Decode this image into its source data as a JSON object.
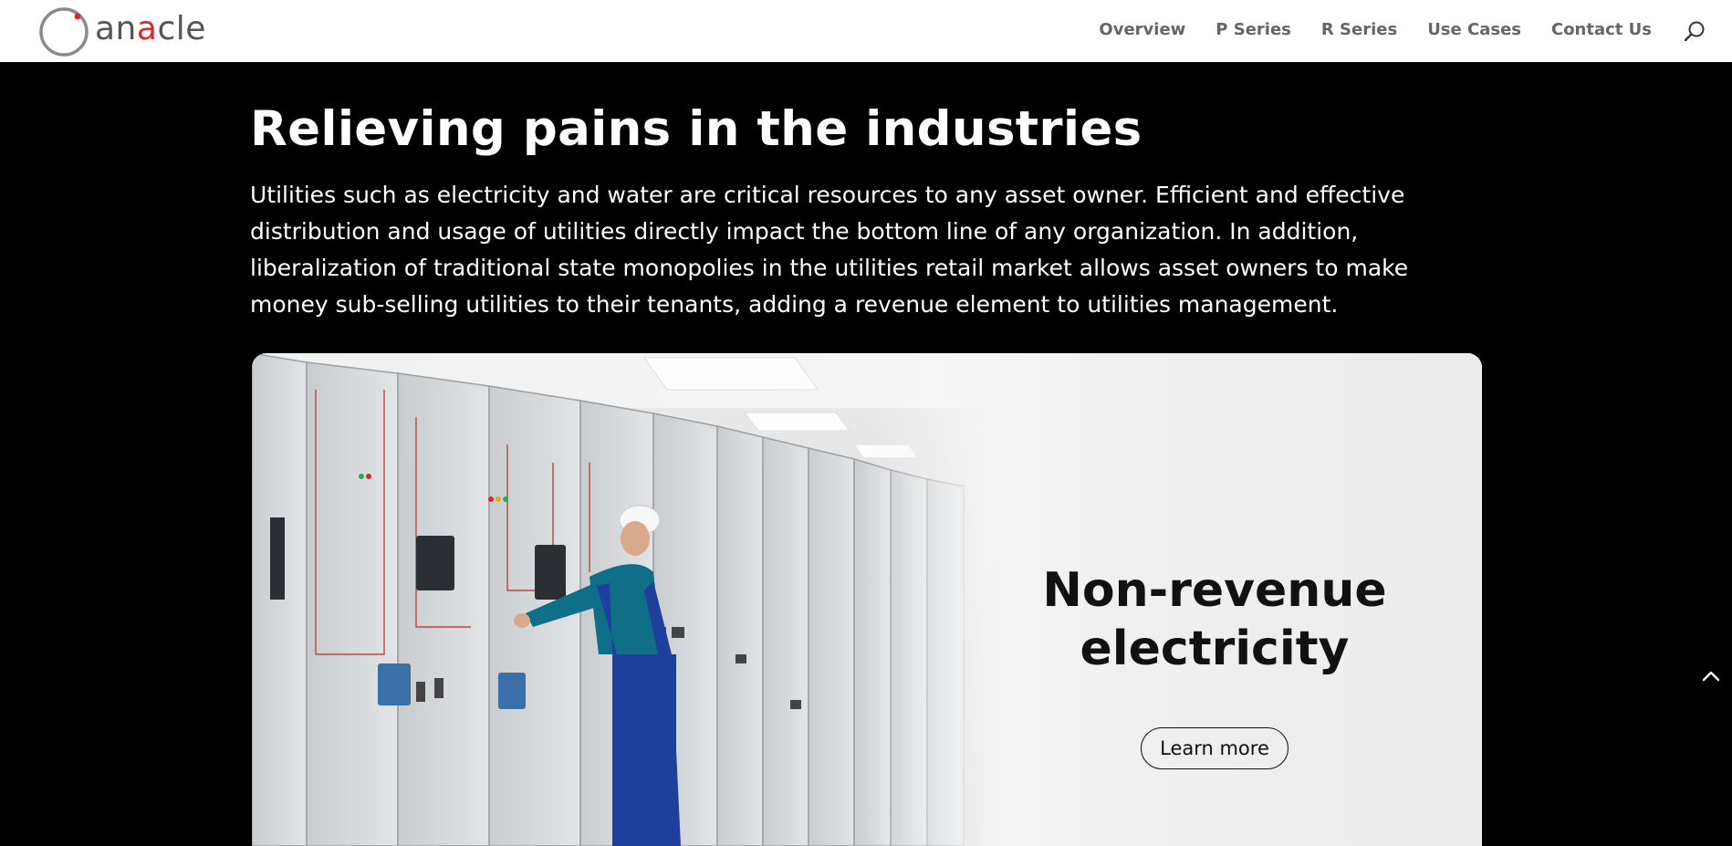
{
  "header": {
    "logo": {
      "prefix": "an",
      "accent": "a",
      "suffix": "cle"
    },
    "nav": [
      {
        "label": "Overview"
      },
      {
        "label": "P Series"
      },
      {
        "label": "R Series"
      },
      {
        "label": "Use Cases"
      },
      {
        "label": "Contact Us"
      }
    ],
    "search_icon": "search-icon"
  },
  "hero": {
    "title": "Relieving pains in the industries",
    "body": "Utilities such as electricity and water are critical resources to any asset owner.  Efficient and effective distribution and usage of utilities directly impact the bottom line of any organization. In addition, liberalization of traditional state monopolies in the utilities retail market allows asset owners to make money sub-selling utilities to their tenants, adding a revenue element to utilities management."
  },
  "card": {
    "title_line1": "Non-revenue",
    "title_line2": "electricity",
    "button_label": "Learn more"
  },
  "colors": {
    "background": "#000000",
    "header": "#ffffff",
    "nav_text": "#666666",
    "logo_accent": "#d8282a"
  },
  "icons": {
    "back_to_top": "chevron-up-icon"
  }
}
